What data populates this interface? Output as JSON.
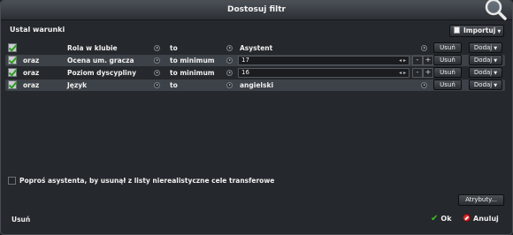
{
  "window": {
    "title": "Dostosuj filtr"
  },
  "section_label": "Ustal warunki",
  "import_button": "Importuj",
  "conditions": [
    {
      "enabled": true,
      "conjunction": "",
      "field": "Rola w klubie",
      "operator": "to",
      "value": "Asystent",
      "input": false
    },
    {
      "enabled": true,
      "conjunction": "oraz",
      "field": "Ocena um. gracza",
      "operator": "to minimum",
      "value": "17",
      "input": true
    },
    {
      "enabled": true,
      "conjunction": "oraz",
      "field": "Poziom dyscypliny",
      "operator": "to minimum",
      "value": "16",
      "input": true
    },
    {
      "enabled": true,
      "conjunction": "oraz",
      "field": "Język",
      "operator": "to",
      "value": "angielski",
      "input": false
    }
  ],
  "row_actions": {
    "remove_label": "Usuń",
    "add_label": "Dodaj"
  },
  "stepper": {
    "minus": "-",
    "plus": "+"
  },
  "assistant_checkbox": {
    "label": "Poproś asystenta, by usunął z listy nierealistyczne cele transferowe",
    "checked": false
  },
  "attributes_button": "Atrybuty...",
  "footer": {
    "remove_label": "Usuń",
    "ok_label": "Ok",
    "cancel_label": "Anuluj"
  },
  "colors": {
    "accent_check": "#2d9c1f",
    "ok_icon": "#3fbf2a",
    "cancel_icon": "#d32a2a"
  }
}
